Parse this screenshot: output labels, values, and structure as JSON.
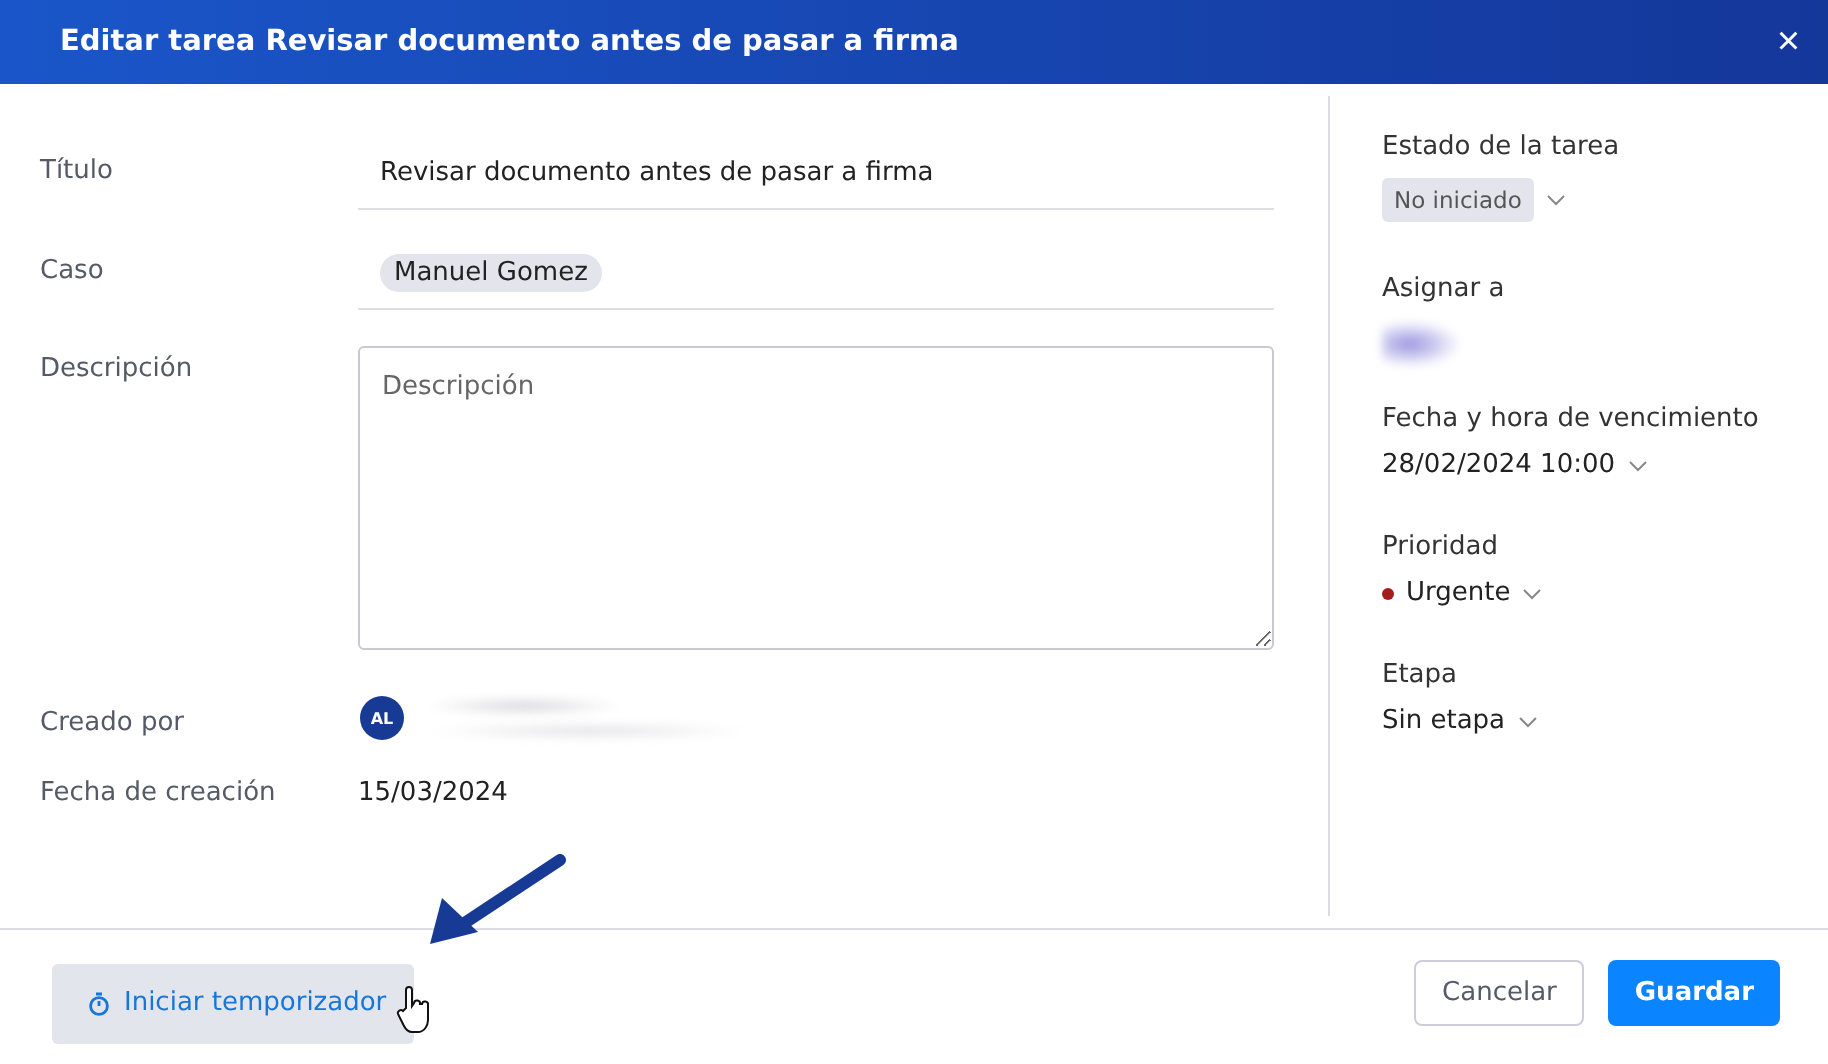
{
  "dialog": {
    "title": "Editar tarea Revisar documento antes de pasar a firma",
    "close": "×"
  },
  "form": {
    "title": {
      "label": "Título",
      "value": "Revisar documento antes de pasar a firma"
    },
    "case": {
      "label": "Caso",
      "chip": "Manuel Gomez"
    },
    "description": {
      "label": "Descripción",
      "placeholder": "Descripción"
    },
    "created_by": {
      "label": "Creado por",
      "initials": "AL"
    },
    "created_on": {
      "label": "Fecha de creación",
      "value": "15/03/2024"
    }
  },
  "sidebar": {
    "status": {
      "label": "Estado de la tarea",
      "value": "No iniciado"
    },
    "assignee": {
      "label": "Asignar a"
    },
    "due": {
      "label": "Fecha y hora de vencimiento",
      "value": "28/02/2024 10:00"
    },
    "priority": {
      "label": "Prioridad",
      "value": "Urgente"
    },
    "stage": {
      "label": "Etapa",
      "value": "Sin etapa"
    }
  },
  "footer": {
    "timer": "Iniciar temporizador",
    "cancel": "Cancelar",
    "save": "Guardar"
  }
}
